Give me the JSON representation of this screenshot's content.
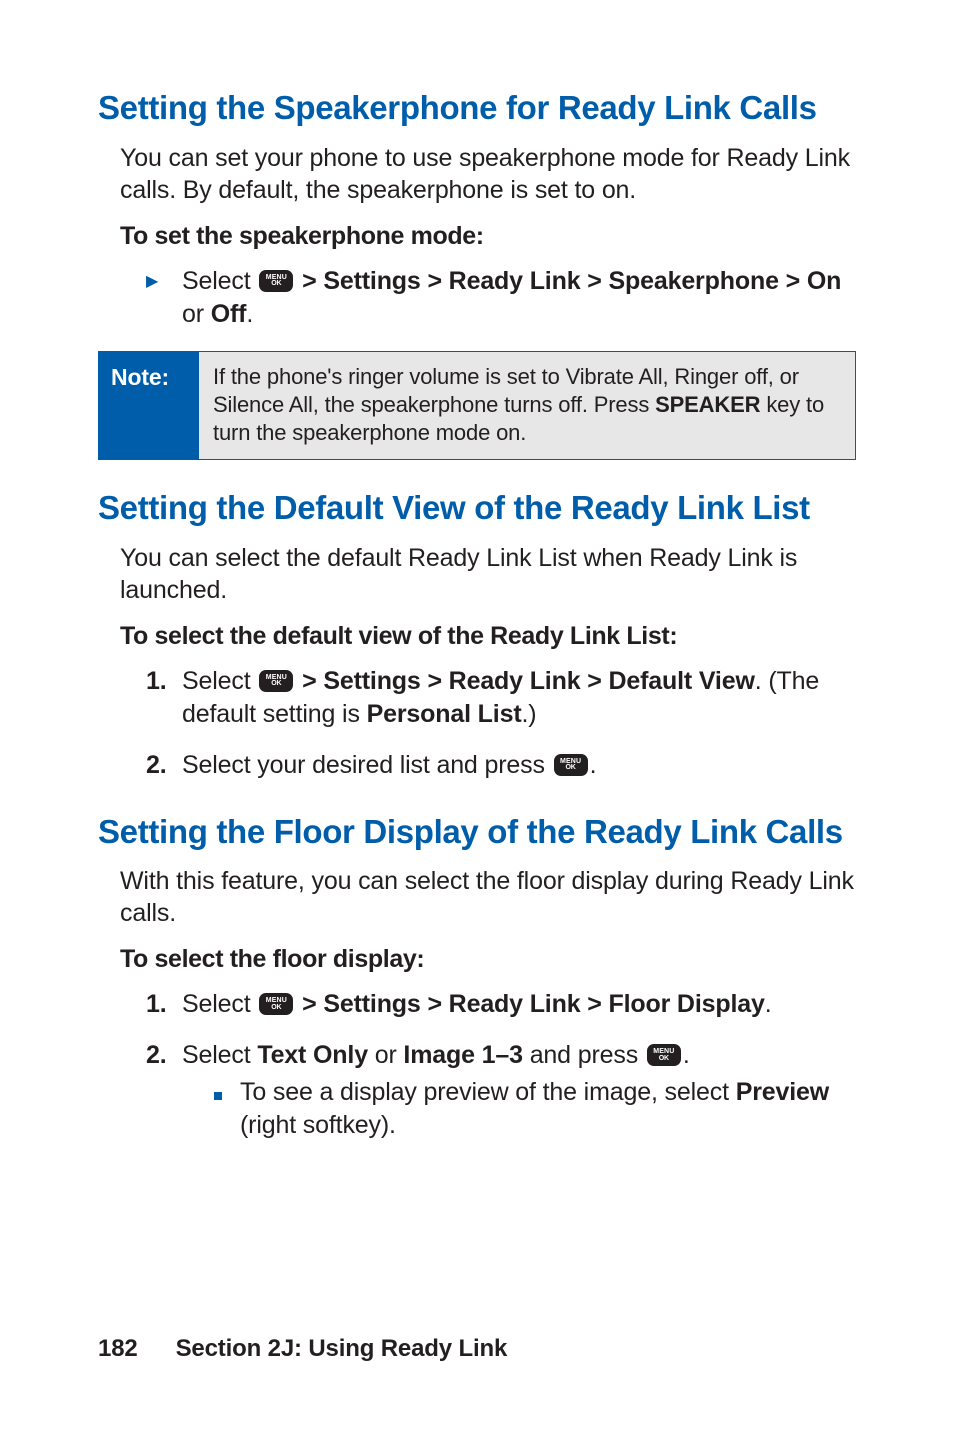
{
  "icons": {
    "menu_ok": "MENU/OK"
  },
  "sections": {
    "speakerphone": {
      "heading": "Setting the Speakerphone for Ready Link Calls",
      "intro": "You can set your phone to use speakerphone mode for Ready Link calls. By default, the speakerphone is set to on.",
      "subhead": "To set the speakerphone mode:",
      "step_prefix": "Select ",
      "step_bold": " > Settings > Ready Link > Speakerphone > On",
      "step_tail": " or ",
      "step_tail_bold": "Off",
      "step_end": "."
    },
    "note": {
      "label": "Note:",
      "body_pre": "If the phone's ringer volume is set to Vibrate All, Ringer off, or Silence All, the speakerphone turns off. Press ",
      "body_bold": "SPEAKER",
      "body_post": " key to turn the speakerphone mode on."
    },
    "defaultview": {
      "heading": "Setting the Default View of the Ready Link List",
      "intro": "You can select the default Ready Link List when Ready Link is launched.",
      "subhead": "To select the default view of the Ready Link List:",
      "step1_num": "1.",
      "step1_pre": "Select ",
      "step1_bold": " > Settings > Ready Link > Default View",
      "step1_mid": ". (The default setting is ",
      "step1_bold2": "Personal List",
      "step1_end": ".)",
      "step2_num": "2.",
      "step2_pre": "Select your desired list and press ",
      "step2_end": "."
    },
    "floor": {
      "heading": "Setting the Floor Display of the Ready Link Calls",
      "intro": "With this feature, you can select the floor display during Ready Link calls.",
      "subhead": "To select the floor display:",
      "step1_num": "1.",
      "step1_pre": "Select ",
      "step1_bold": " > Settings > Ready Link > Floor Display",
      "step1_end": ".",
      "step2_num": "2.",
      "step2_pre": "Select ",
      "step2_bold1": "Text Only",
      "step2_mid": " or ",
      "step2_bold2": "Image 1–3",
      "step2_mid2": " and press ",
      "step2_end": ".",
      "sub_pre": "To see a display preview of the image, select ",
      "sub_bold": "Preview",
      "sub_post": " (right softkey)."
    }
  },
  "footer": {
    "page_number": "182",
    "section_label": "Section 2J: Using Ready Link"
  }
}
